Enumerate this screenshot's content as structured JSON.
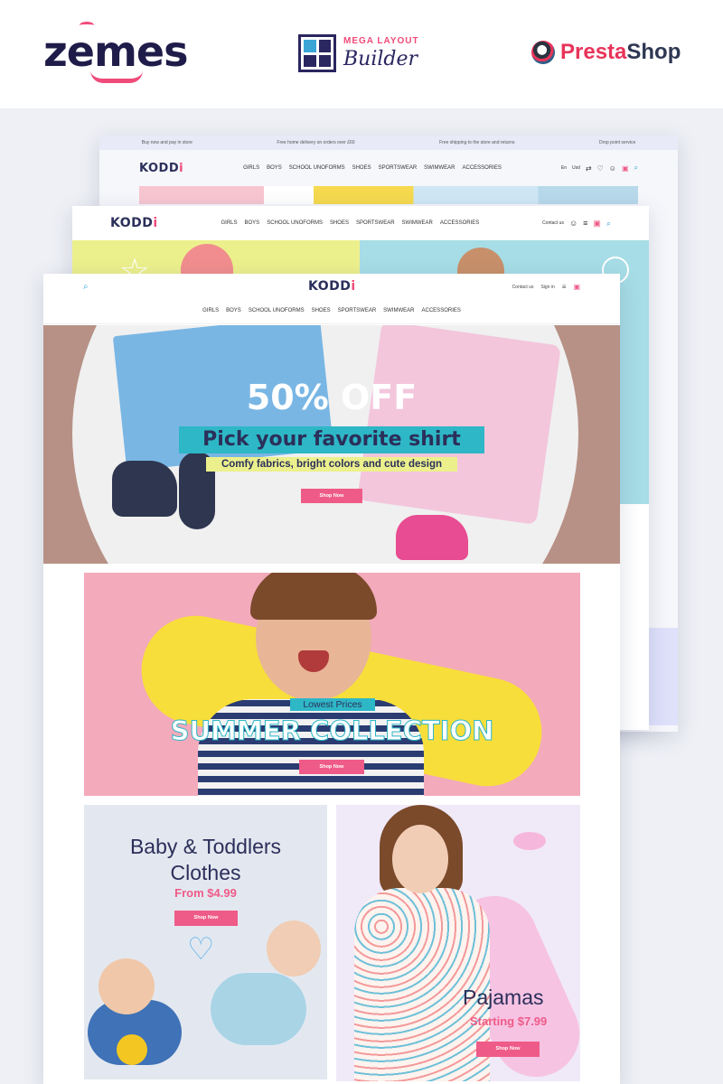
{
  "brands": {
    "zemes": "zemes",
    "mega_layout_line1": "MEGA LAYOUT",
    "mega_layout_line2": "Builder",
    "prestashop_a": "Presta",
    "prestashop_b": "Shop"
  },
  "store_logo": {
    "main": "KODD",
    "accent": "i"
  },
  "layer1": {
    "topbar": [
      "Buy now and pay in store",
      "Free home delivery on orders over £60",
      "Free shipping to the store and returns",
      "Drop point service"
    ],
    "menu": [
      "GIRLS",
      "BOYS",
      "SCHOOL UNOFORMS",
      "SHOES",
      "SPORTSWEAR",
      "SWIMWEAR",
      "ACCESSORIES"
    ],
    "lang": "En",
    "currency": "Usd"
  },
  "layer2": {
    "menu": [
      "GIRLS",
      "BOYS",
      "SCHOOL UNOFORMS",
      "SHOES",
      "SPORTSWEAR",
      "SWIMWEAR",
      "ACCESSORIES"
    ],
    "contact": "Contact us"
  },
  "front": {
    "header": {
      "contact": "Contact us",
      "signin": "Sign in"
    },
    "menu": [
      "GIRLS",
      "BOYS",
      "SCHOOL UNOFORMS",
      "SHOES",
      "SPORTSWEAR",
      "SWIMWEAR",
      "ACCESSORIES"
    ],
    "hero": {
      "discount": "50% OFF",
      "headline": "Pick your favorite shirt",
      "subline": "Comfy fabrics, bright colors and cute design",
      "cta": "Shop Now"
    },
    "summer": {
      "tag": "Lowest Prices",
      "title": "SUMMER COLLECTION",
      "cta": "Shop Now"
    },
    "baby": {
      "title_line1": "Baby & Toddlers",
      "title_line2": "Clothes",
      "price": "From $4.99",
      "cta": "Shop Now"
    },
    "pajamas": {
      "title": "Pajamas",
      "price": "Starting $7.99",
      "cta": "Shop Now"
    }
  },
  "colors": {
    "brand_pink": "#ef5b88",
    "teal": "#2eb7c6",
    "navy": "#2b2f5a",
    "yellow": "#ecf08c"
  },
  "icons": [
    "search-icon",
    "heart-icon",
    "cart-icon",
    "user-icon",
    "menu-icon",
    "compare-icon"
  ]
}
